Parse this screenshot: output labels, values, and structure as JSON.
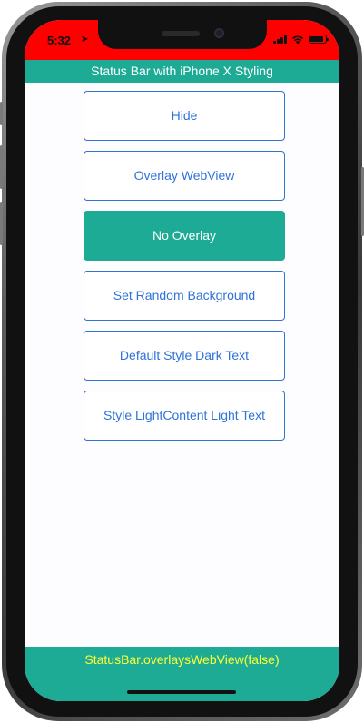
{
  "status_bar": {
    "time": "5:32",
    "location_icon": "location-arrow-icon",
    "icons": [
      "signal-icon",
      "wifi-icon",
      "battery-icon"
    ],
    "background_color": "#ff0000"
  },
  "header": {
    "title": "Status Bar with iPhone X Styling",
    "background_color": "#1eab96"
  },
  "buttons": [
    {
      "label": "Hide",
      "active": false
    },
    {
      "label": "Overlay WebView",
      "active": false
    },
    {
      "label": "No Overlay",
      "active": true
    },
    {
      "label": "Set Random Background",
      "active": false
    },
    {
      "label": "Default Style Dark Text",
      "active": false
    },
    {
      "label": "Style LightContent Light Text",
      "active": false
    }
  ],
  "footer": {
    "text": "StatusBar.overlaysWebView(false)",
    "text_color": "#ffff33"
  },
  "colors": {
    "accent": "#1eab96",
    "button_border": "#2f72d8"
  }
}
